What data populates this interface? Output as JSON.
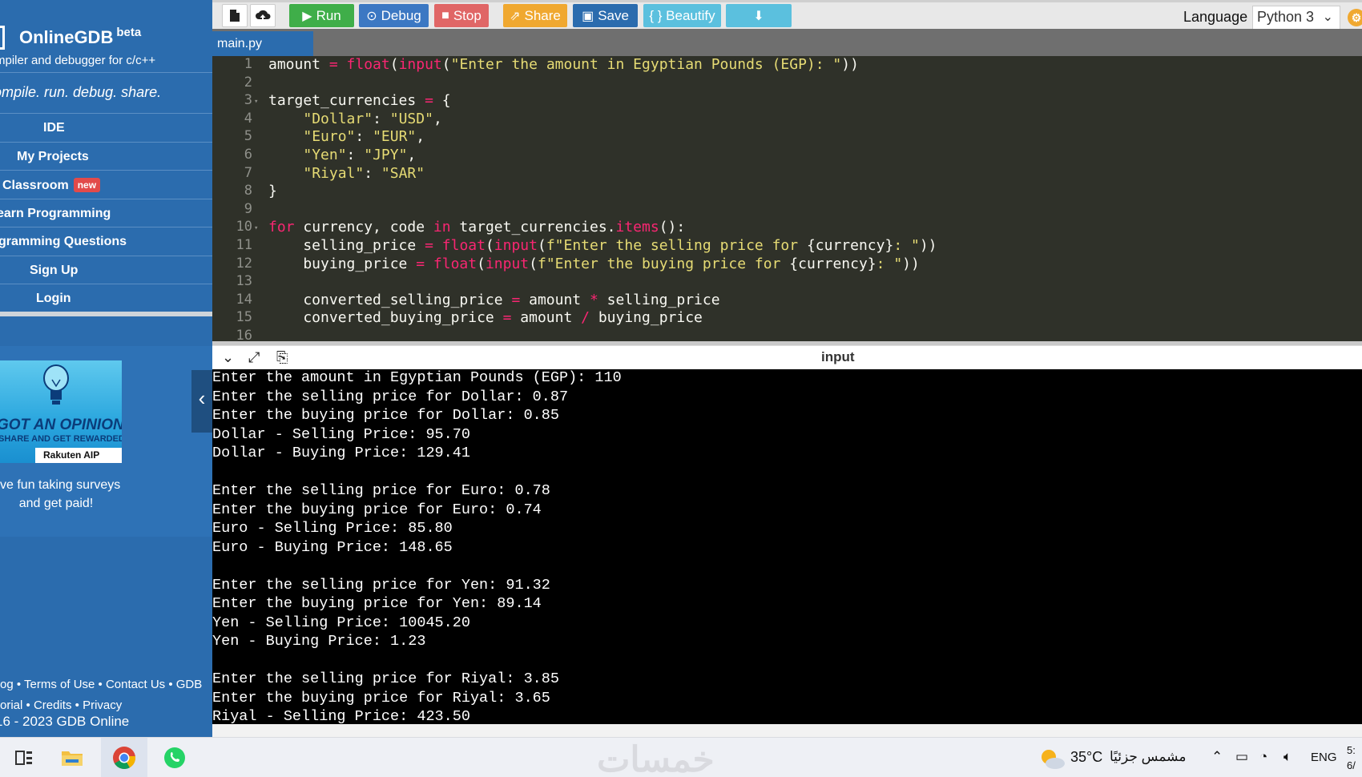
{
  "sidebar": {
    "brand": "OnlineGDB",
    "brand_badge": "beta",
    "brand_sub": "mpiler and debugger for c/c++",
    "tagline": "ompile. run. debug. share.",
    "nav": {
      "ide": "IDE",
      "projects": "My Projects",
      "classroom": "Classroom",
      "classroom_badge": "new",
      "learn": "earn Programming",
      "questions": "gramming Questions",
      "signup": "Sign Up",
      "login": "Login"
    },
    "ad": {
      "headline": "GOT AN OPINION?",
      "sub": "SHARE AND GET REWARDED.",
      "brand": "Rakuten AIP",
      "text_line1": "ve fun taking surveys",
      "text_line2": "and get paid!"
    },
    "footer": {
      "link_blog": "og",
      "link_terms": "Terms of Use",
      "link_contact": "Contact Us",
      "link_gdb": "GDB",
      "link_tutorial": "orial",
      "link_credits": "Credits",
      "link_privacy": "Privacy",
      "copyright": "16 - 2023 GDB Online"
    }
  },
  "toolbar": {
    "run": "Run",
    "debug": "Debug",
    "stop": "Stop",
    "share": "Share",
    "save": "Save",
    "beautify": "{ } Beautify",
    "language_label": "Language",
    "language_value": "Python 3",
    "colors": {
      "run": "#3fae49",
      "debug": "#3c78c3",
      "stop": "#e06666",
      "share": "#f0a830",
      "save": "#2b6cae",
      "beautify": "#5bc0de",
      "download": "#5bc0de"
    }
  },
  "editor": {
    "tab": "main.py",
    "lines": [
      {
        "n": "1",
        "fold": false,
        "html": "amount <span class='op'>=</span> <span class='fn'>float</span>(<span class='fn'>input</span>(<span class='str'>\"Enter the amount in Egyptian Pounds (EGP): \"</span>))"
      },
      {
        "n": "2",
        "fold": false,
        "html": ""
      },
      {
        "n": "3",
        "fold": true,
        "html": "target_currencies <span class='op'>=</span> {"
      },
      {
        "n": "4",
        "fold": false,
        "html": "    <span class='str'>\"Dollar\"</span>: <span class='str'>\"USD\"</span>,"
      },
      {
        "n": "5",
        "fold": false,
        "html": "    <span class='str'>\"Euro\"</span>: <span class='str'>\"EUR\"</span>,"
      },
      {
        "n": "6",
        "fold": false,
        "html": "    <span class='str'>\"Yen\"</span>: <span class='str'>\"JPY\"</span>,"
      },
      {
        "n": "7",
        "fold": false,
        "html": "    <span class='str'>\"Riyal\"</span>: <span class='str'>\"SAR\"</span>"
      },
      {
        "n": "8",
        "fold": false,
        "html": "}"
      },
      {
        "n": "9",
        "fold": false,
        "html": ""
      },
      {
        "n": "10",
        "fold": true,
        "html": "<span class='kw'>for</span> currency, code <span class='kw'>in</span> target_currencies.<span class='fn'>items</span>():"
      },
      {
        "n": "11",
        "fold": false,
        "html": "    selling_price <span class='op'>=</span> <span class='fn'>float</span>(<span class='fn'>input</span>(<span class='str'>f\"Enter the selling price for </span>{currency}<span class='str'>: \"</span>))"
      },
      {
        "n": "12",
        "fold": false,
        "html": "    buying_price <span class='op'>=</span> <span class='fn'>float</span>(<span class='fn'>input</span>(<span class='str'>f\"Enter the buying price for </span>{currency}<span class='str'>: \"</span>))"
      },
      {
        "n": "13",
        "fold": false,
        "html": ""
      },
      {
        "n": "14",
        "fold": false,
        "html": "    converted_selling_price <span class='op'>=</span> amount <span class='op'>*</span> selling_price"
      },
      {
        "n": "15",
        "fold": false,
        "html": "    converted_buying_price <span class='op'>=</span> amount <span class='op'>/</span> buying_price"
      },
      {
        "n": "16",
        "fold": false,
        "html": ""
      }
    ]
  },
  "output": {
    "title": "input",
    "lines": [
      "Enter the amount in Egyptian Pounds (EGP): 110",
      "Enter the selling price for Dollar: 0.87",
      "Enter the buying price for Dollar: 0.85",
      "Dollar - Selling Price: 95.70",
      "Dollar - Buying Price: 129.41",
      "",
      "Enter the selling price for Euro: 0.78",
      "Enter the buying price for Euro: 0.74",
      "Euro - Selling Price: 85.80",
      "Euro - Buying Price: 148.65",
      "",
      "Enter the selling price for Yen: 91.32",
      "Enter the buying price for Yen: 89.14",
      "Yen - Selling Price: 10045.20",
      "Yen - Buying Price: 1.23",
      "",
      "Enter the selling price for Riyal: 3.85",
      "Enter the buying price for Riyal: 3.65",
      "Riyal - Selling Price: 423.50"
    ]
  },
  "taskbar": {
    "watermark": "خمسات",
    "temperature": "35°C",
    "weather_desc": "مشمس جزئيًا",
    "lang": "ENG",
    "clock_time": "5:",
    "clock_date": "6/"
  }
}
